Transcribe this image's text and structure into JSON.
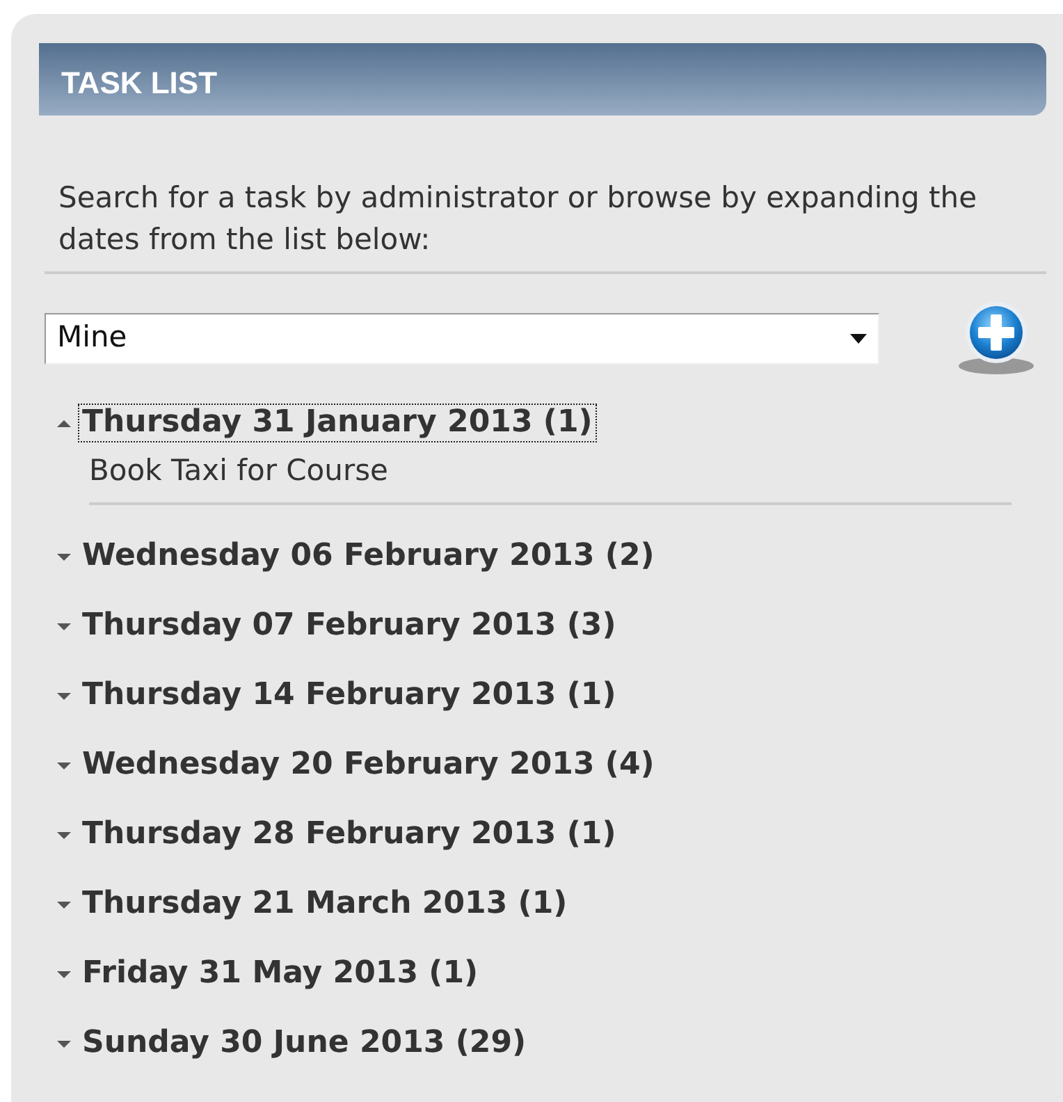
{
  "panel": {
    "title": "TASK LIST"
  },
  "intro": "Search for a task by administrator or browse by expanding the dates from the list below:",
  "filter": {
    "value": "Mine"
  },
  "dates": [
    {
      "label": "Thursday 31 January 2013 (1)",
      "expanded": true,
      "focused": true,
      "tasks": [
        "Book Taxi for Course"
      ]
    },
    {
      "label": "Wednesday 06 February 2013 (2)",
      "expanded": false,
      "focused": false
    },
    {
      "label": "Thursday 07 February 2013 (3)",
      "expanded": false,
      "focused": false
    },
    {
      "label": "Thursday 14 February 2013 (1)",
      "expanded": false,
      "focused": false
    },
    {
      "label": "Wednesday 20 February 2013 (4)",
      "expanded": false,
      "focused": false
    },
    {
      "label": "Thursday 28 February 2013 (1)",
      "expanded": false,
      "focused": false
    },
    {
      "label": "Thursday 21 March 2013 (1)",
      "expanded": false,
      "focused": false
    },
    {
      "label": "Friday 31 May 2013 (1)",
      "expanded": false,
      "focused": false
    },
    {
      "label": "Sunday 30 June 2013 (29)",
      "expanded": false,
      "focused": false
    }
  ]
}
